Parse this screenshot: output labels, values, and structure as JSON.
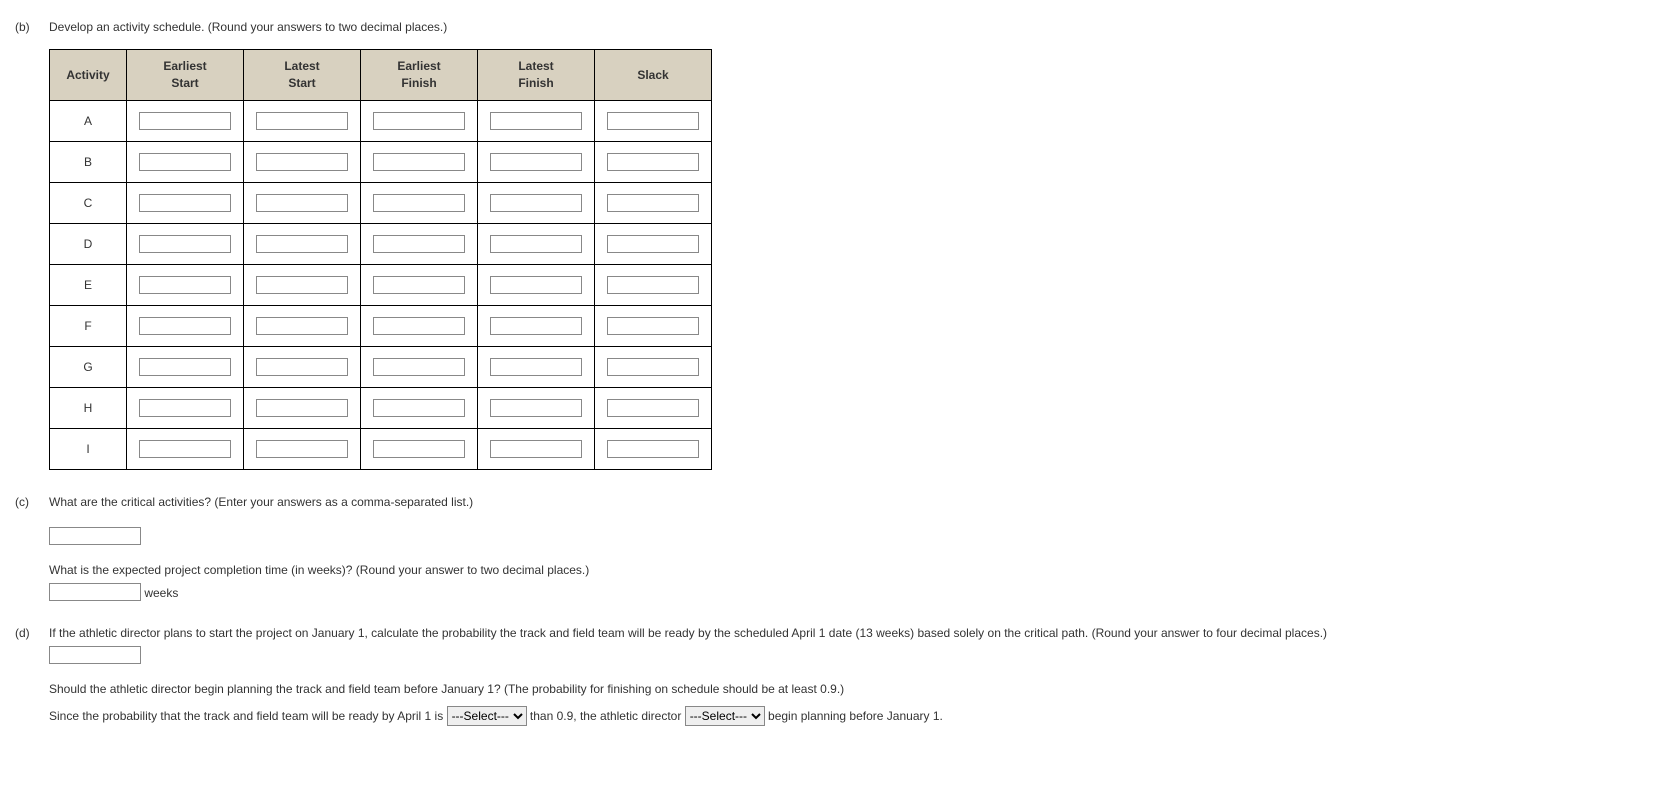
{
  "partB": {
    "label": "(b)",
    "prompt": "Develop an activity schedule. (Round your answers to two decimal places.)",
    "headers": {
      "activity": "Activity",
      "es": "Earliest\nStart",
      "ls": "Latest\nStart",
      "ef": "Earliest\nFinish",
      "lf": "Latest\nFinish",
      "slack": "Slack"
    },
    "rows": [
      "A",
      "B",
      "C",
      "D",
      "E",
      "F",
      "G",
      "H",
      "I"
    ]
  },
  "partC": {
    "label": "(c)",
    "prompt": "What are the critical activities? (Enter your answers as a comma-separated list.)",
    "subPrompt": "What is the expected project completion time (in weeks)? (Round your answer to two decimal places.)",
    "unit": "weeks"
  },
  "partD": {
    "label": "(d)",
    "prompt": "If the athletic director plans to start the project on January 1, calculate the probability the track and field team will be ready by the scheduled April 1 date (13 weeks) based solely on the critical path. (Round your answer to four decimal places.)",
    "followupPrompt": "Should the athletic director begin planning the track and field team before January 1? (The probability for finishing on schedule should be at least 0.9.)",
    "sentence": {
      "s1": "Since the probability that the track and field team will be ready by April 1 is",
      "s2": "than 0.9, the athletic director",
      "s3": "begin planning before January 1."
    },
    "selectPlaceholder": "---Select---"
  }
}
